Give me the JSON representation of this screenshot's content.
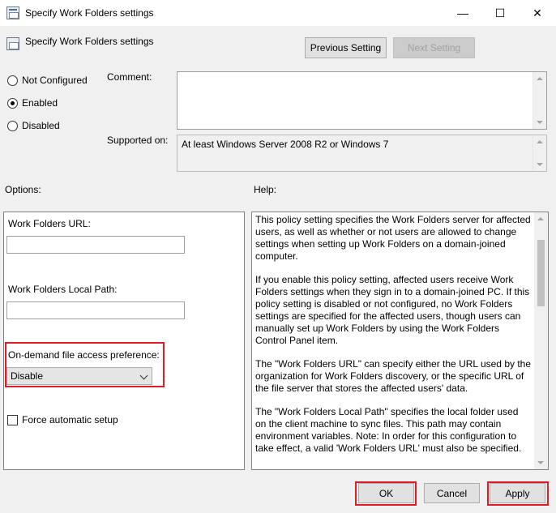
{
  "window": {
    "title": "Specify Work Folders settings",
    "controls": {
      "minimize": "—",
      "maximize": "☐",
      "close": "✕"
    }
  },
  "header": {
    "title": "Specify Work Folders settings",
    "prev_label": "Previous Setting",
    "next_label": "Next Setting"
  },
  "state": {
    "options": [
      {
        "label": "Not Configured",
        "checked": false
      },
      {
        "label": "Enabled",
        "checked": true
      },
      {
        "label": "Disabled",
        "checked": false
      }
    ]
  },
  "comment": {
    "label": "Comment:",
    "value": ""
  },
  "supported": {
    "label": "Supported on:",
    "value": "At least Windows Server 2008 R2 or Windows 7"
  },
  "options_panel": {
    "heading": "Options:",
    "url_label": "Work Folders URL:",
    "url_value": "",
    "path_label": "Work Folders Local Path:",
    "path_value": "",
    "ondemand_label": "On-demand file access preference:",
    "ondemand_value": "Disable",
    "force_label": "Force automatic setup",
    "force_checked": false
  },
  "help": {
    "heading": "Help:",
    "paragraphs": [
      "This policy setting specifies the Work Folders server for affected users, as well as whether or not users are allowed to change settings when setting up Work Folders on a domain-joined computer.",
      "If you enable this policy setting, affected users receive Work Folders settings when they sign in to a domain-joined PC. If this policy setting is disabled or not configured, no Work Folders settings are specified for the affected users, though users can manually set up Work Folders by using the Work Folders Control Panel item.",
      "The \"Work Folders URL\" can specify either the URL used by the organization for Work Folders discovery, or the specific URL of the file server that stores the affected users' data.",
      "The \"Work Folders Local Path\" specifies the local folder used on the client machine to sync files. This path may contain environment variables. Note: In order for this configuration to take effect, a valid 'Work Folders URL' must also be specified."
    ]
  },
  "footer": {
    "ok_label": "OK",
    "cancel_label": "Cancel",
    "apply_label": "Apply"
  },
  "colors": {
    "highlight": "#e01b24",
    "background": "#f0f0f0"
  }
}
